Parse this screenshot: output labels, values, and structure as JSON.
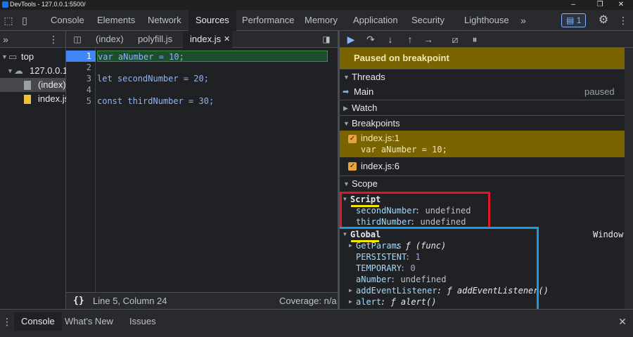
{
  "window": {
    "title": "DevTools - 127.0.0.1:5500/",
    "minimize": "–",
    "restore": "❐",
    "close": "✕"
  },
  "main_tabs": [
    "Console",
    "Elements",
    "Network",
    "Sources",
    "Performance",
    "Memory",
    "Application",
    "Security",
    "Lighthouse"
  ],
  "active_main_tab": "Sources",
  "toolbar": {
    "more_tabs": "»",
    "issues_count": "1",
    "settings_icon": "gear-icon",
    "menu_icon": "kebab-icon"
  },
  "navigator": {
    "more": "»",
    "tree": [
      {
        "label": "top",
        "icon": "frame-icon"
      },
      {
        "label": "127.0.0.1:5500",
        "icon": "cloud-icon"
      },
      {
        "label": "(index)",
        "icon": "file-icon"
      },
      {
        "label": "index.js",
        "icon": "js-file-icon"
      }
    ]
  },
  "editor": {
    "tabs": [
      "(index)",
      "polyfill.js",
      "index.js"
    ],
    "active_tab": "index.js",
    "lines": [
      {
        "n": "1",
        "text": "var aNumber = 10;"
      },
      {
        "n": "2",
        "text": ""
      },
      {
        "n": "3",
        "text": "let secondNumber = 20;"
      },
      {
        "n": "4",
        "text": ""
      },
      {
        "n": "5",
        "text": "const thirdNumber = 30;"
      }
    ],
    "status": {
      "braces": "{}",
      "position": "Line 5, Column 24",
      "coverage": "Coverage: n/a"
    }
  },
  "debugger": {
    "paused": "Paused on breakpoint",
    "threads": {
      "header": "Threads",
      "thread": "Main",
      "state": "paused"
    },
    "watch": "Watch",
    "breakpoints": {
      "header": "Breakpoints",
      "items": [
        {
          "location": "index.js:1",
          "code": "var aNumber = 10;"
        },
        {
          "location": "index.js:6",
          "code": ""
        }
      ]
    },
    "scope": {
      "header": "Scope",
      "script": {
        "label": "Script",
        "vars": [
          {
            "name": "secondNumber",
            "value": "undefined"
          },
          {
            "name": "thirdNumber",
            "value": "undefined"
          }
        ]
      },
      "global": {
        "label": "Global",
        "kind": "Window",
        "vars": [
          {
            "name": "GetParams",
            "value": "ƒ (func)"
          },
          {
            "name": "PERSISTENT",
            "value": "1"
          },
          {
            "name": "TEMPORARY",
            "value": "0"
          },
          {
            "name": "aNumber",
            "value": "undefined"
          },
          {
            "name": "addEventListener",
            "value": "ƒ addEventListener()"
          },
          {
            "name": "alert",
            "value": "ƒ alert()"
          }
        ]
      }
    }
  },
  "drawer": {
    "tabs": [
      "Console",
      "What's New",
      "Issues"
    ],
    "active": "Console",
    "close": "✕",
    "menu": "⋮"
  },
  "colors": {
    "accent": "#4285f4",
    "paused": "#7a6400",
    "annotation_red": "#e0162b",
    "annotation_blue": "#1a9be6",
    "annotation_yellow": "#f7e600"
  }
}
